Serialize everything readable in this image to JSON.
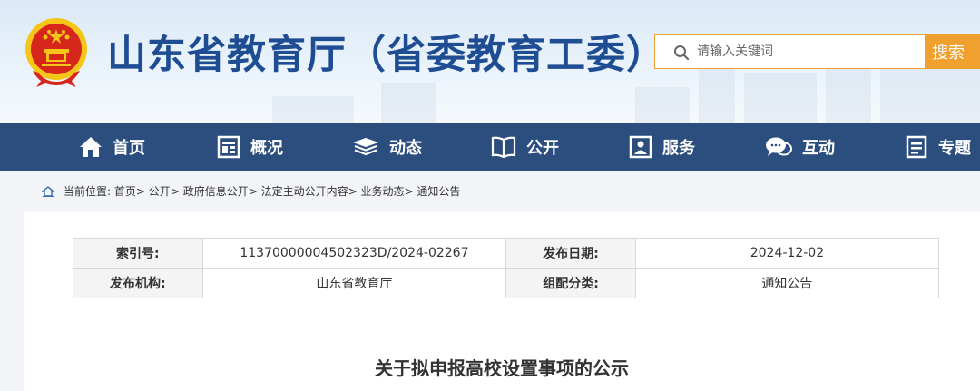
{
  "header": {
    "title": "山东省教育厅（省委教育工委）",
    "search": {
      "placeholder": "请输入关键词",
      "button": "搜索"
    }
  },
  "nav": [
    {
      "label": "首页",
      "icon": "home-icon"
    },
    {
      "label": "概况",
      "icon": "overview-icon"
    },
    {
      "label": "动态",
      "icon": "news-stack-icon"
    },
    {
      "label": "公开",
      "icon": "open-book-icon"
    },
    {
      "label": "服务",
      "icon": "service-icon"
    },
    {
      "label": "互动",
      "icon": "chat-icon"
    },
    {
      "label": "专题",
      "icon": "topic-icon"
    }
  ],
  "breadcrumb": {
    "prefix": "当前位置:",
    "items": [
      "首页",
      "公开",
      "政府信息公开",
      "法定主动公开内容",
      "业务动态",
      "通知公告"
    ],
    "separator": ">"
  },
  "meta": {
    "index_label": "索引号:",
    "index_value": "11370000004502323D/2024-02267",
    "date_label": "发布日期:",
    "date_value": "2024-12-02",
    "org_label": "发布机构:",
    "org_value": "山东省教育厅",
    "category_label": "组配分类:",
    "category_value": "通知公告"
  },
  "article": {
    "title": "关于拟申报高校设置事项的公示"
  },
  "colors": {
    "nav_bg": "#2b4e7e",
    "title": "#1f4d94",
    "accent": "#f0a02e",
    "emblem_red": "#d7261c",
    "emblem_gold": "#f5c518"
  }
}
